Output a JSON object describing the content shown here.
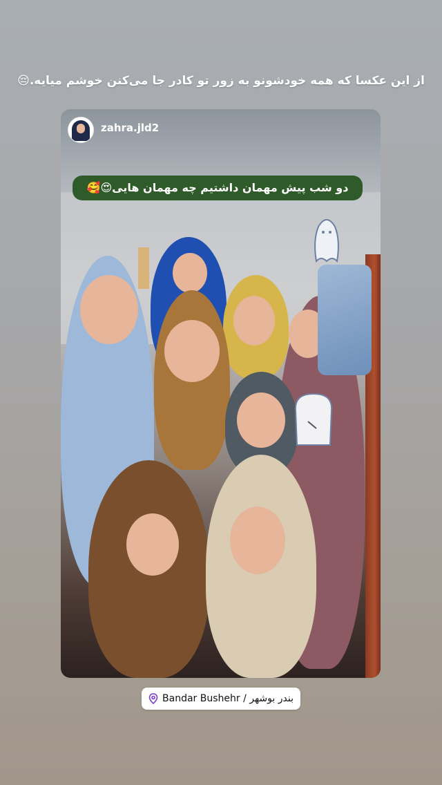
{
  "story": {
    "caption": "از این عکسا که همه خودشونو به زور تو کادر جا می‌کنن خوشم میایه.😔"
  },
  "shared_post": {
    "username": "zahra.jld2",
    "caption": "دو شب پیش مهمان داشتیم چه مهمان هایی😍🥰"
  },
  "location": {
    "icon": "location-pin-icon",
    "label": "Bandar Bushehr / بندر بوشهر"
  },
  "colors": {
    "caption_bg": "#2f5a2a",
    "pin": "#7a3fd1"
  }
}
